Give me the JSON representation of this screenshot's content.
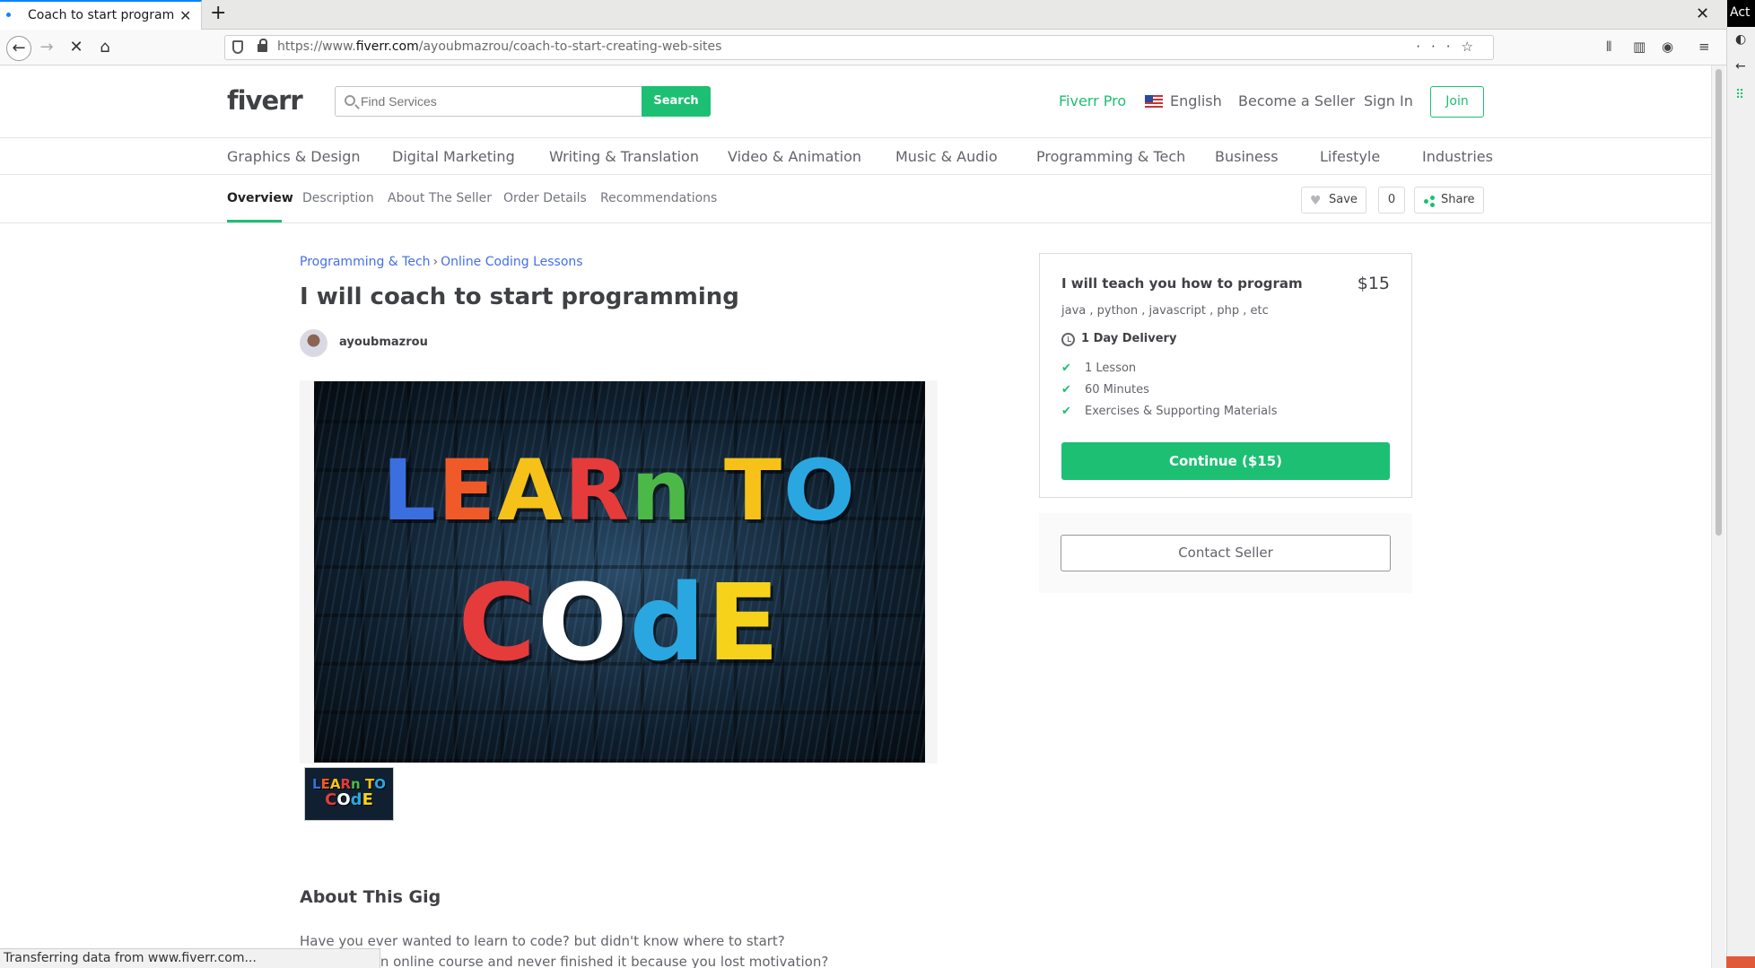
{
  "browser": {
    "tab_title": "Coach to start programmi",
    "url_prefix": "https://www.",
    "url_domain": "fiverr.com",
    "url_path": "/ayoubmazrou/coach-to-start-creating-web-sites",
    "status_text": "Transferring data from www.fiverr.com...",
    "top_right_label": "Act"
  },
  "header": {
    "logo": "fiverr",
    "search_placeholder": "Find Services",
    "search_button": "Search",
    "fiverr_pro": "Fiverr Pro",
    "language": "English",
    "become_seller": "Become a Seller",
    "sign_in": "Sign In",
    "join": "Join"
  },
  "categories": [
    "Graphics & Design",
    "Digital Marketing",
    "Writing & Translation",
    "Video & Animation",
    "Music & Audio",
    "Programming & Tech",
    "Business",
    "Lifestyle",
    "Industries"
  ],
  "subnav": {
    "items": [
      "Overview",
      "Description",
      "About The Seller",
      "Order Details",
      "Recommendations"
    ],
    "save": "Save",
    "save_count": "0",
    "share": "Share"
  },
  "gig": {
    "breadcrumb": [
      "Programming & Tech",
      "Online Coding Lessons"
    ],
    "title": "I will coach to start programming",
    "seller": "ayoubmazrou",
    "image_text": {
      "line1": [
        "L",
        "E",
        "A",
        "R",
        "n",
        " ",
        "T",
        "O"
      ],
      "line1_colors": [
        "#3b6fe0",
        "#f05a28",
        "#f6c21a",
        "#e63b3b",
        "#4cb848",
        "#ffffff",
        "#f6c21a",
        "#2aa7e0"
      ],
      "line2": [
        "C",
        "O",
        "d",
        "E"
      ],
      "line2_colors": [
        "#e63b3b",
        "#ffffff",
        "#2aa7e0",
        "#f6d31a"
      ]
    },
    "about_title": "About This Gig",
    "about_lines": [
      "Have you ever wanted to learn to code? but didn't know where to start?",
      "Or bought an online course and never finished it because you lost motivation?"
    ]
  },
  "package": {
    "title": "I will teach you how to program",
    "price": "$15",
    "description": "java , python , javascript , php , etc",
    "delivery": "1 Day Delivery",
    "features": [
      "1 Lesson",
      "60 Minutes",
      "Exercises & Supporting Materials"
    ],
    "continue": "Continue ($15)",
    "contact": "Contact Seller"
  },
  "colors": {
    "brand_green": "#1dbf73",
    "link_blue": "#446ee7",
    "text_dark": "#404145"
  }
}
